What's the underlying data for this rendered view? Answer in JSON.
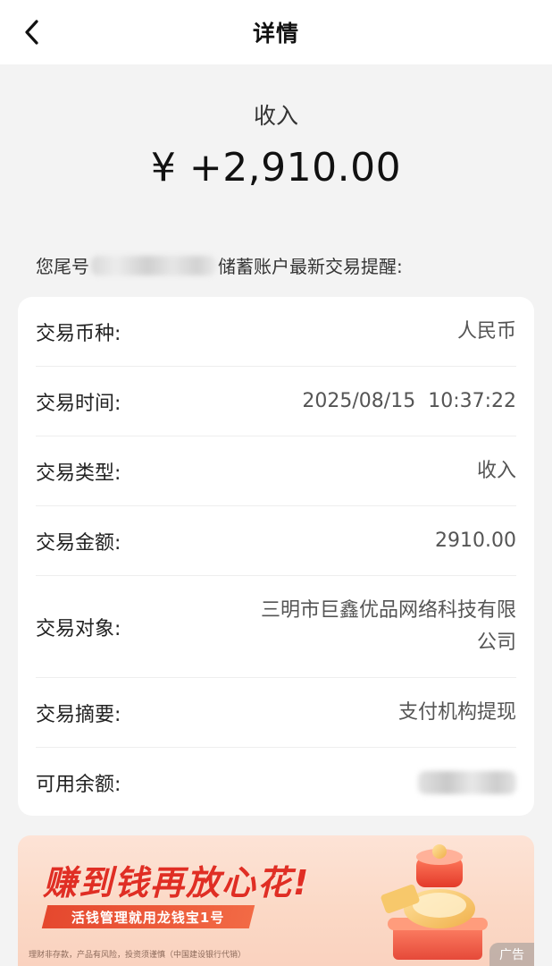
{
  "nav": {
    "title": "详情"
  },
  "summary": {
    "type": "收入",
    "amount": "¥ +2,910.00"
  },
  "notice": {
    "prefix": "您尾号",
    "suffix": "储蓄账户最新交易提醒:"
  },
  "details": [
    {
      "label": "交易币种:",
      "value": "人民币"
    },
    {
      "label": "交易时间:",
      "value": "2025/08/15  10:37:22"
    },
    {
      "label": "交易类型:",
      "value": "收入"
    },
    {
      "label": "交易金额:",
      "value": "2910.00"
    },
    {
      "label": "交易对象:",
      "value": "三明市巨鑫优品网络科技有限公司"
    },
    {
      "label": "交易摘要:",
      "value": "支付机构提现"
    },
    {
      "label": "可用余额:",
      "value": ""
    }
  ],
  "ad": {
    "headline": "赚到钱再放心花!",
    "subline": "活钱管理就用龙钱宝1号",
    "disclaimer": "理财非存款，产品有风险，投资须谨慎（中国建设银行代销）",
    "badge": "广告"
  },
  "colors": {
    "accent_red": "#e02e24",
    "background": "#f3f3f3",
    "card": "#ffffff"
  }
}
